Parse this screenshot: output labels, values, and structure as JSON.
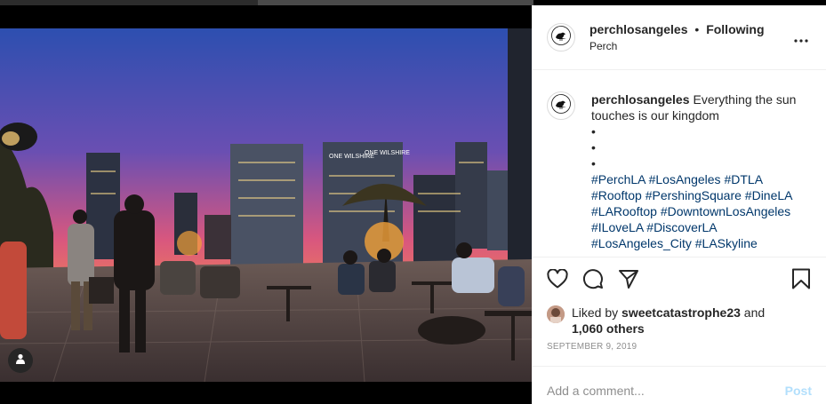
{
  "post": {
    "image_alt": "Rooftop terrace at sunset with Los Angeles skyline",
    "tag_icon": "user-icon"
  },
  "header": {
    "username": "perchlosangeles",
    "separator": "•",
    "follow_status": "Following",
    "location": "Perch",
    "more_icon": "more-horizontal-icon"
  },
  "caption": {
    "username": "perchlosangeles",
    "text": "Everything the sun touches is our kingdom",
    "bullets": [
      "•",
      "•",
      "•"
    ],
    "hashtags": [
      "#PerchLA",
      "#LosAngeles",
      "#DTLA",
      "#Rooftop",
      "#PershingSquare",
      "#DineLA",
      "#LARooftop",
      "#DowntownLosAngeles",
      "#ILoveLA",
      "#DiscoverLA",
      "#LosAngeles_City",
      "#LASkyline"
    ]
  },
  "actions": {
    "like_icon": "heart-icon",
    "comment_icon": "comment-icon",
    "share_icon": "send-icon",
    "save_icon": "bookmark-icon"
  },
  "likes": {
    "prefix": "Liked by",
    "user": "sweetcatastrophe23",
    "connector": "and",
    "others": "1,060 others"
  },
  "date": "September 9, 2019",
  "comment": {
    "placeholder": "Add a comment...",
    "post_label": "Post"
  },
  "colors": {
    "hashtag": "#00376b",
    "post_disabled": "#b2dffc",
    "muted": "#8e8e8e",
    "border": "#efefef"
  }
}
